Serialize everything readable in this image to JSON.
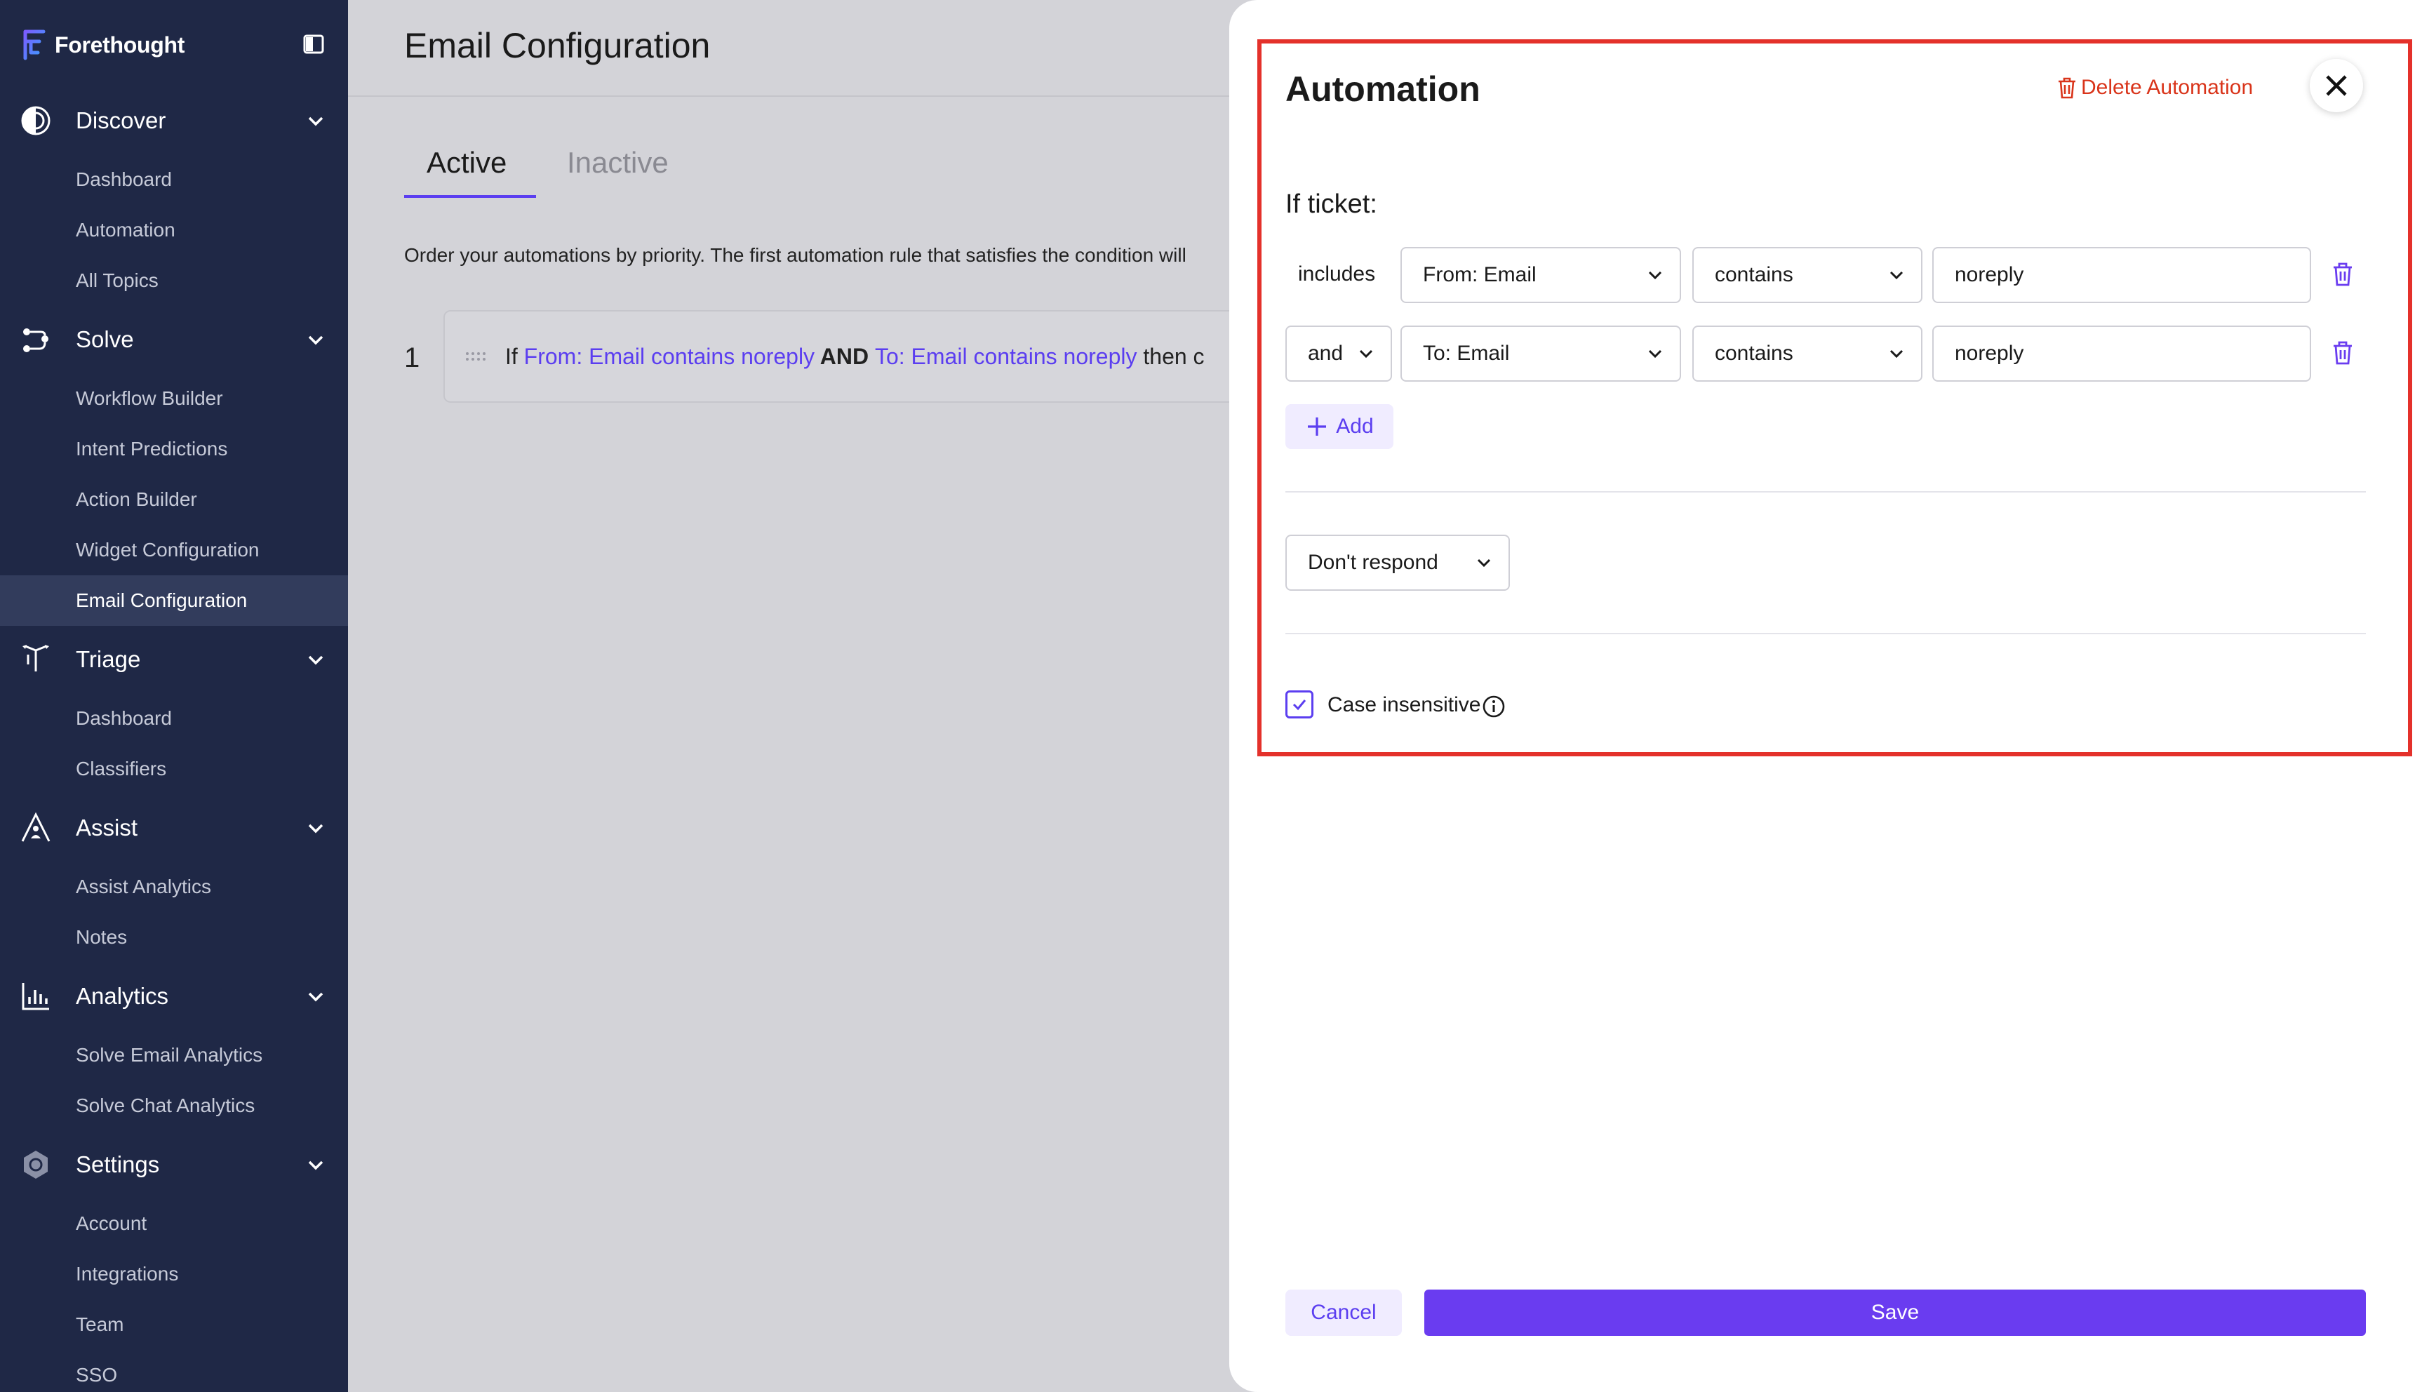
{
  "brand": {
    "name": "Forethought"
  },
  "sidebar": {
    "sections": [
      {
        "label": "Discover",
        "icon": "discover-icon",
        "items": [
          "Dashboard",
          "Automation",
          "All Topics"
        ]
      },
      {
        "label": "Solve",
        "icon": "solve-icon",
        "items": [
          "Workflow Builder",
          "Intent Predictions",
          "Action Builder",
          "Widget Configuration",
          "Email Configuration"
        ]
      },
      {
        "label": "Triage",
        "icon": "triage-icon",
        "items": [
          "Dashboard",
          "Classifiers"
        ]
      },
      {
        "label": "Assist",
        "icon": "assist-icon",
        "items": [
          "Assist Analytics",
          "Notes"
        ]
      },
      {
        "label": "Analytics",
        "icon": "analytics-icon",
        "items": [
          "Solve Email Analytics",
          "Solve Chat Analytics"
        ]
      },
      {
        "label": "Settings",
        "icon": "settings-icon",
        "items": [
          "Account",
          "Integrations",
          "Team",
          "SSO"
        ]
      }
    ],
    "active_item": "Email Configuration"
  },
  "main": {
    "title": "Email Configuration",
    "tabs": [
      {
        "label": "Active"
      },
      {
        "label": "Inactive"
      }
    ],
    "description": "Order your automations by priority. The first automation rule that satisfies the condition will",
    "rule": {
      "index": "1",
      "prefix": "If ",
      "cond1": "From: Email contains noreply",
      "joiner": " AND ",
      "cond2": "To: Email contains noreply",
      "suffix": " then c"
    }
  },
  "drawer": {
    "title": "Automation",
    "delete_label": "Delete Automation",
    "if_label": "If ticket:",
    "conditions": [
      {
        "operator_label": "includes",
        "field": "From: Email",
        "comparator": "contains",
        "value": "noreply"
      },
      {
        "operator_select": "and",
        "field": "To: Email",
        "comparator": "contains",
        "value": "noreply"
      }
    ],
    "add_label": "Add",
    "action": "Don't respond",
    "case_insensitive_label": "Case insensitive",
    "case_insensitive_checked": true,
    "cancel_label": "Cancel",
    "save_label": "Save"
  },
  "colors": {
    "accent": "#6a3cf0",
    "danger": "#d9341a",
    "highlight": "#e4312b",
    "sidebar_bg": "#1f2846"
  }
}
